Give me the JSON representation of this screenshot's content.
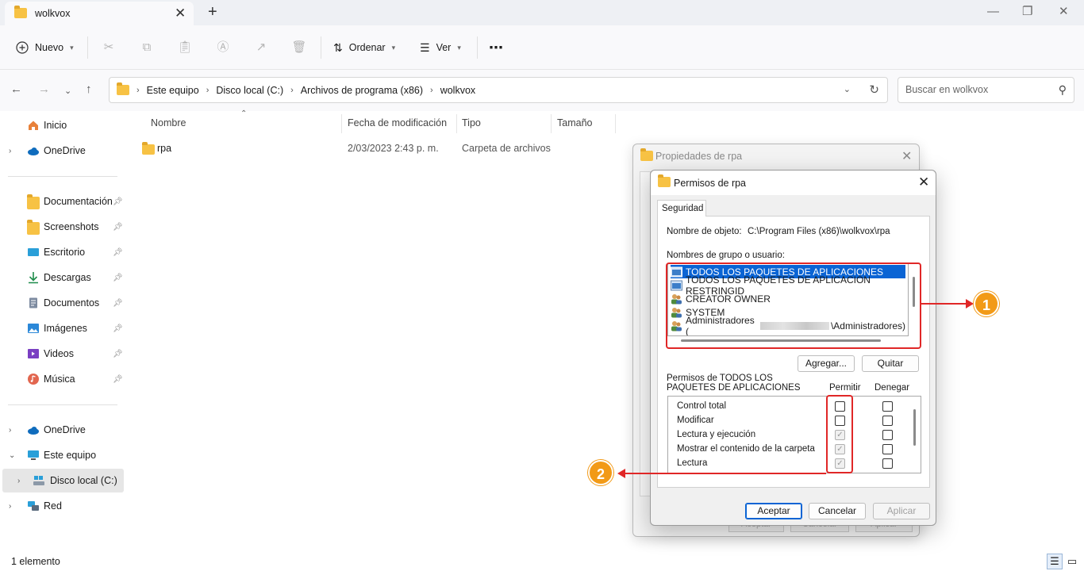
{
  "window": {
    "tab_title": "wolkvox",
    "close_tab": "✕",
    "new_tab": "+",
    "minimize": "—",
    "maximize": "❐",
    "close": "✕"
  },
  "toolbar": {
    "new_label": "Nuevo",
    "sort_label": "Ordenar",
    "view_label": "Ver",
    "more_label": "⋯"
  },
  "address": {
    "crumbs": [
      "Este equipo",
      "Disco local (C:)",
      "Archivos de programa (x86)",
      "wolkvox"
    ],
    "search_placeholder": "Buscar en wolkvox"
  },
  "sidebar": {
    "items": [
      {
        "label": "Inicio"
      },
      {
        "label": "OneDrive"
      },
      {
        "label": "Documentación"
      },
      {
        "label": "Screenshots"
      },
      {
        "label": "Escritorio"
      },
      {
        "label": "Descargas"
      },
      {
        "label": "Documentos"
      },
      {
        "label": "Imágenes"
      },
      {
        "label": "Videos"
      },
      {
        "label": "Música"
      },
      {
        "label": "OneDrive"
      },
      {
        "label": "Este equipo"
      },
      {
        "label": "Disco local (C:)"
      },
      {
        "label": "Red"
      }
    ]
  },
  "columns": {
    "name": "Nombre",
    "modified": "Fecha de modificación",
    "type": "Tipo",
    "size": "Tamaño"
  },
  "files": [
    {
      "name": "rpa",
      "modified": "2/03/2023 2:43 p. m.",
      "type": "Carpeta de archivos",
      "size": ""
    }
  ],
  "status": {
    "count": "1 elemento"
  },
  "props_dialog": {
    "title": "Propiedades de rpa",
    "buttons": [
      "Aceptar",
      "Cancelar",
      "Aplicar"
    ]
  },
  "perm_dialog": {
    "title": "Permisos de rpa",
    "tab": "Seguridad",
    "object_label": "Nombre de objeto:",
    "object_value": "C:\\Program Files (x86)\\wolkvox\\rpa",
    "group_label": "Nombres de grupo o usuario:",
    "users": [
      {
        "name": "TODOS LOS PAQUETES DE APLICACIONES",
        "selected": true
      },
      {
        "name": "TODOS LOS PAQUETES DE APLICACIÓN RESTRINGID",
        "selected": false
      },
      {
        "name": "CREATOR OWNER",
        "selected": false
      },
      {
        "name": "SYSTEM",
        "selected": false
      },
      {
        "name_prefix": "Administradores (",
        "name_suffix": "\\Administradores)",
        "selected": false
      }
    ],
    "add_button": "Agregar...",
    "remove_button": "Quitar",
    "perm_for_line1": "Permisos de TODOS LOS",
    "perm_for_line2": "PAQUETES DE APLICACIONES",
    "allow_header": "Permitir",
    "deny_header": "Denegar",
    "permissions": [
      {
        "name": "Control total",
        "allow": false,
        "deny": false
      },
      {
        "name": "Modificar",
        "allow": false,
        "deny": false
      },
      {
        "name": "Lectura y ejecución",
        "allow": true,
        "deny": false
      },
      {
        "name": "Mostrar el contenido de la carpeta",
        "allow": true,
        "deny": false
      },
      {
        "name": "Lectura",
        "allow": true,
        "deny": false
      }
    ],
    "ok_button": "Aceptar",
    "cancel_button": "Cancelar",
    "apply_button": "Aplicar"
  },
  "annotations": {
    "badge1": "1",
    "badge2": "2",
    "color": "#e02727",
    "badge_color": "#f29a17"
  }
}
